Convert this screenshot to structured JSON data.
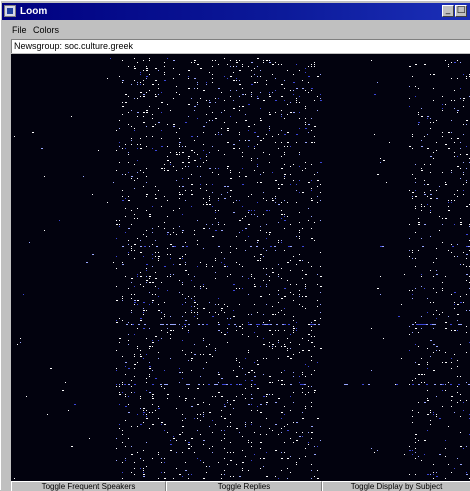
{
  "window": {
    "title": "Loom",
    "icon": "loom-app-icon",
    "controls": [
      "minimize-icon",
      "maximize-icon"
    ]
  },
  "menu": [
    "File",
    "Colors"
  ],
  "newsgroup": {
    "text": "Newsgroup: soc.culture.greek"
  },
  "visualization": {
    "background_color": "#02020e",
    "dot_colors": [
      "#ffffff",
      "#9aa8ff",
      "#3b46d8"
    ]
  },
  "toolbar": [
    "Toggle Frequent Speakers",
    "Toggle Replies",
    "Toggle Display by Subject"
  ]
}
